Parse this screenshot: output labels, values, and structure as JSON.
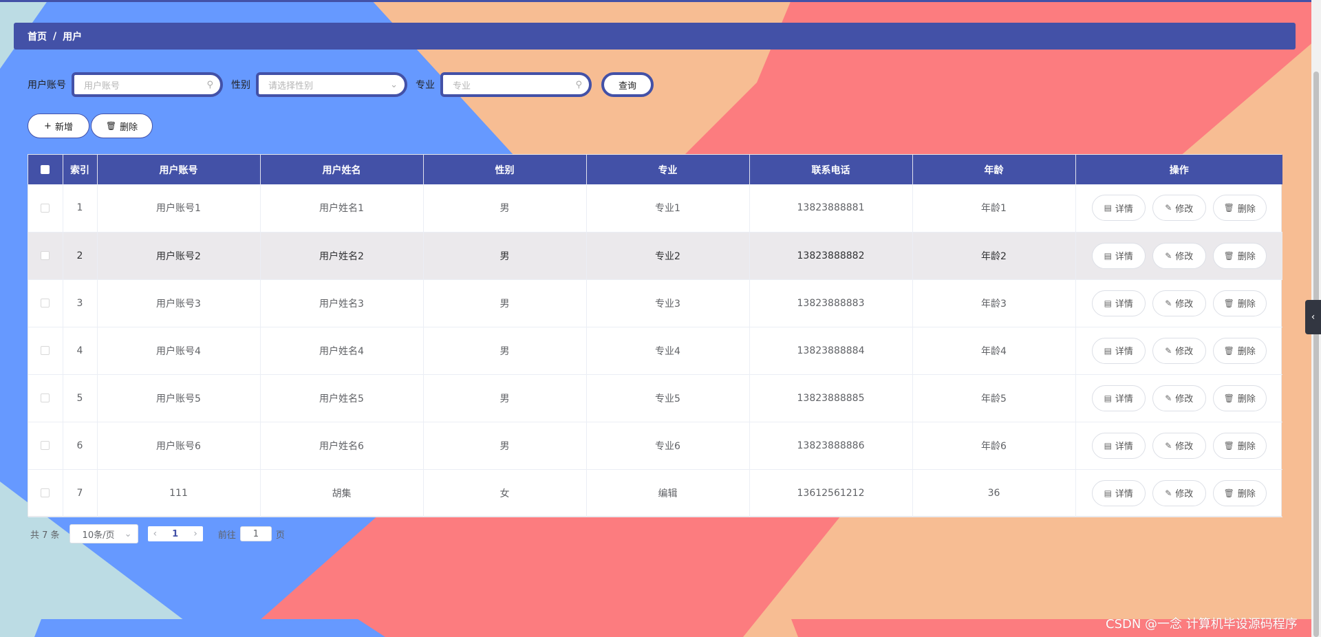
{
  "breadcrumb": {
    "home": "首页",
    "separator": "/",
    "current": "用户"
  },
  "search": {
    "account_label": "用户账号",
    "account_placeholder": "用户账号",
    "gender_label": "性别",
    "gender_placeholder": "请选择性别",
    "major_label": "专业",
    "major_placeholder": "专业",
    "query_label": "查询"
  },
  "actions": {
    "add_label": "新增",
    "delete_label": "删除"
  },
  "table": {
    "columns": [
      "索引",
      "用户账号",
      "用户姓名",
      "性别",
      "专业",
      "联系电话",
      "年龄",
      "操作"
    ],
    "rows": [
      [
        "1",
        "用户账号1",
        "用户姓名1",
        "男",
        "专业1",
        "13823888881",
        "年龄1"
      ],
      [
        "2",
        "用户账号2",
        "用户姓名2",
        "男",
        "专业2",
        "13823888882",
        "年龄2"
      ],
      [
        "3",
        "用户账号3",
        "用户姓名3",
        "男",
        "专业3",
        "13823888883",
        "年龄3"
      ],
      [
        "4",
        "用户账号4",
        "用户姓名4",
        "男",
        "专业4",
        "13823888884",
        "年龄4"
      ],
      [
        "5",
        "用户账号5",
        "用户姓名5",
        "男",
        "专业5",
        "13823888885",
        "年龄5"
      ],
      [
        "6",
        "用户账号6",
        "用户姓名6",
        "男",
        "专业6",
        "13823888886",
        "年龄6"
      ],
      [
        "7",
        "111",
        "胡集",
        "女",
        "编辑",
        "13612561212",
        "36"
      ]
    ],
    "row_actions": {
      "detail": "详情",
      "edit": "修改",
      "delete": "删除"
    }
  },
  "pagination": {
    "total": "共 7 条",
    "page_size": "10条/页",
    "current_page": "1",
    "goto_prefix": "前往",
    "goto_value": "1",
    "goto_suffix": "页"
  },
  "watermark": "CSDN @一念 计算机毕设源码程序",
  "colors": {
    "primary": "#4351a7",
    "bg_blue": "#6699ff",
    "bg_peach": "#f7bd93",
    "bg_coral": "#fc7c7f",
    "bg_lightblue": "#bcdce4"
  }
}
